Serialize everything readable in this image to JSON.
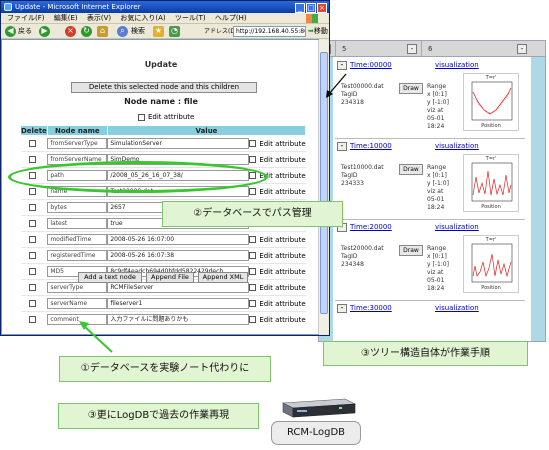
{
  "tree_window": {
    "header_cells": [
      "5",
      "6"
    ],
    "nodes": [
      {
        "time_link": "Time:00000",
        "vis_link": "visualization",
        "file": "Test00000.dat",
        "tag_label": "TagID",
        "tag_id": "234318",
        "draw": "Draw",
        "range_label": "Range",
        "range_x": "x [0:1]",
        "range_y": "y [-1:0]",
        "viz_at_label": "viz at",
        "viz_date": "05-01",
        "viz_time": "18:24",
        "plot_title": "T=r'",
        "plot_xlabel": "Position"
      },
      {
        "time_link": "Time:10000",
        "vis_link": "visualization",
        "file": "Test10000.dat",
        "tag_label": "TagID",
        "tag_id": "234333",
        "draw": "Draw",
        "range_label": "Range",
        "range_x": "x [0:1]",
        "range_y": "y [-1:0]",
        "viz_at_label": "viz at",
        "viz_date": "05-01",
        "viz_time": "18:24",
        "plot_title": "T=r'",
        "plot_xlabel": "Position"
      },
      {
        "time_link": "Time:20000",
        "vis_link": "visualization",
        "file": "Test20000.dat",
        "tag_label": "TagID",
        "tag_id": "234348",
        "draw": "Draw",
        "range_label": "Range",
        "range_x": "x [0:1]",
        "range_y": "y [-1:0]",
        "viz_at_label": "viz at",
        "viz_date": "05-01",
        "viz_time": "18:24",
        "plot_title": "T=r'",
        "plot_xlabel": "Position"
      },
      {
        "time_link": "Time:30000",
        "vis_link": "visualization"
      }
    ]
  },
  "ie": {
    "title": "Update - Microsoft Internet Explorer",
    "menu": [
      "ファイル(F)",
      "編集(E)",
      "表示(V)",
      "お気に入り(A)",
      "ツール(T)",
      "ヘルプ(H)"
    ],
    "toolbar": {
      "back": "戻る",
      "search": "検索",
      "address_label": "アドレス(D)",
      "address": "http://192.168.40.55:8080",
      "go": "移動"
    }
  },
  "page": {
    "heading": "Update",
    "delete_button": "Delete this selected node and this children",
    "node_name": "Node name : file",
    "edit_attribute": "Edit attribute",
    "columns": {
      "delete": "Delete",
      "node_name": "Node name",
      "value": "Value"
    },
    "rows": [
      {
        "name": "fromServerType",
        "value": "SimulationServer",
        "edit": "Edit attribute"
      },
      {
        "name": "fromServerName",
        "value": "SimDemo",
        "edit": "Edit attribute"
      },
      {
        "name": "path",
        "value": "/2008_05_26_16_07_38/",
        "edit": "Edit attribute"
      },
      {
        "name": "name",
        "value": "Test00000.dat",
        "edit": "Edit attribute"
      },
      {
        "name": "bytes",
        "value": "2657",
        "edit": "Edit attribute"
      },
      {
        "name": "latest",
        "value": "true",
        "edit": "Edit attribute"
      },
      {
        "name": "modifiedTime",
        "value": "2008-05-26 16:07:00",
        "edit": "Edit attribute"
      },
      {
        "name": "registeredTime",
        "value": "2008-05-26 16:07:38",
        "edit": "Edit attribute"
      },
      {
        "name": "MD5",
        "value": "8c9df4eadcb694d0bfdd5822429decb",
        "edit": "Edit attribute"
      },
      {
        "name": "serverType",
        "value": "RCMFileServer",
        "edit": "Edit attribute"
      },
      {
        "name": "serverName",
        "value": "fileserver1",
        "edit": "Edit attribute"
      },
      {
        "name": "comment",
        "value": "入力ファイルに問題ありかも",
        "edit": "Edit attribute"
      }
    ],
    "buttons": {
      "add_text_node": "Add a text node",
      "append_file": "Append File",
      "append_xml": "Append XML"
    }
  },
  "callouts": {
    "db_path": "②データベースでパス管理",
    "tree_procedure": "③ツリー構造自体が作業手順",
    "notebook": "①データベースを実験ノート代わりに",
    "logdb": "③更にLogDBで過去の作業再現"
  },
  "server_label": "RCM-LogDB",
  "colors": {
    "green_callout_bg": "#e1f5d2",
    "ellipse": "#3ac62e",
    "table_header": "#87cede",
    "tree_stripe": "#add8e6"
  }
}
